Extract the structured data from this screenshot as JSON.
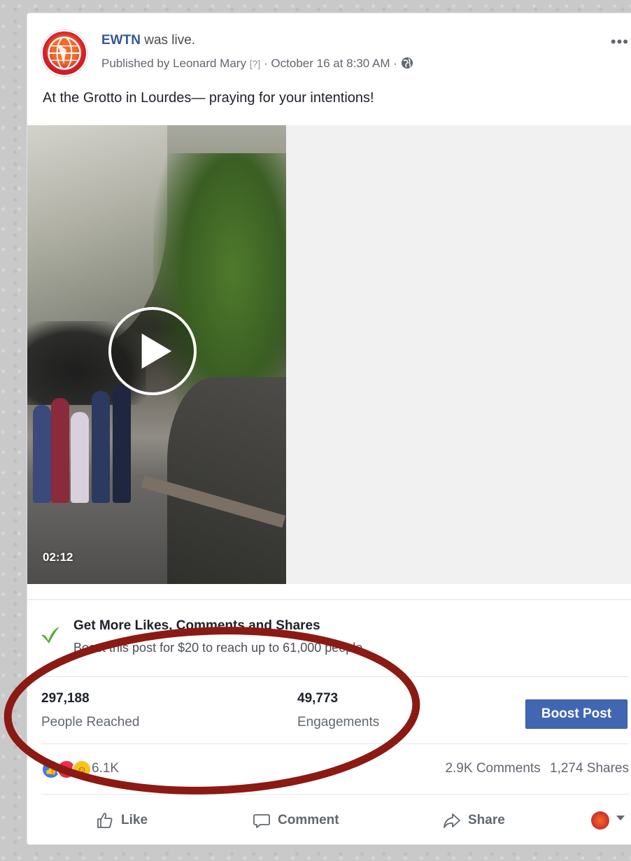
{
  "post": {
    "page_name": "EWTN",
    "status_text": "was live.",
    "published_by": "Published by Leonard Mary",
    "help_marker": "[?]",
    "timestamp": "October 16 at 8:30 AM",
    "separator": "·",
    "more_label": "•••",
    "caption": "At the Grotto in Lourdes— praying for your intentions!"
  },
  "video": {
    "duration": "02:12",
    "play_icon": "play-icon"
  },
  "promo": {
    "title": "Get More Likes, Comments and Shares",
    "subtitle": "Boost this post for $20 to reach up to 61,000 people."
  },
  "stats": {
    "reach_value": "297,188",
    "reach_label": "People Reached",
    "engagement_value": "49,773",
    "engagement_label": "Engagements",
    "boost_button": "Boost Post"
  },
  "reactions": {
    "count": "6.1K",
    "comments": "2.9K Comments",
    "shares": "1,274 Shares"
  },
  "actions": {
    "like": "Like",
    "comment": "Comment",
    "share": "Share"
  },
  "colors": {
    "link_blue": "#365899",
    "boost_blue": "#4267b2",
    "annotation_red": "#8b1a14",
    "promo_check": "#5aa932"
  }
}
